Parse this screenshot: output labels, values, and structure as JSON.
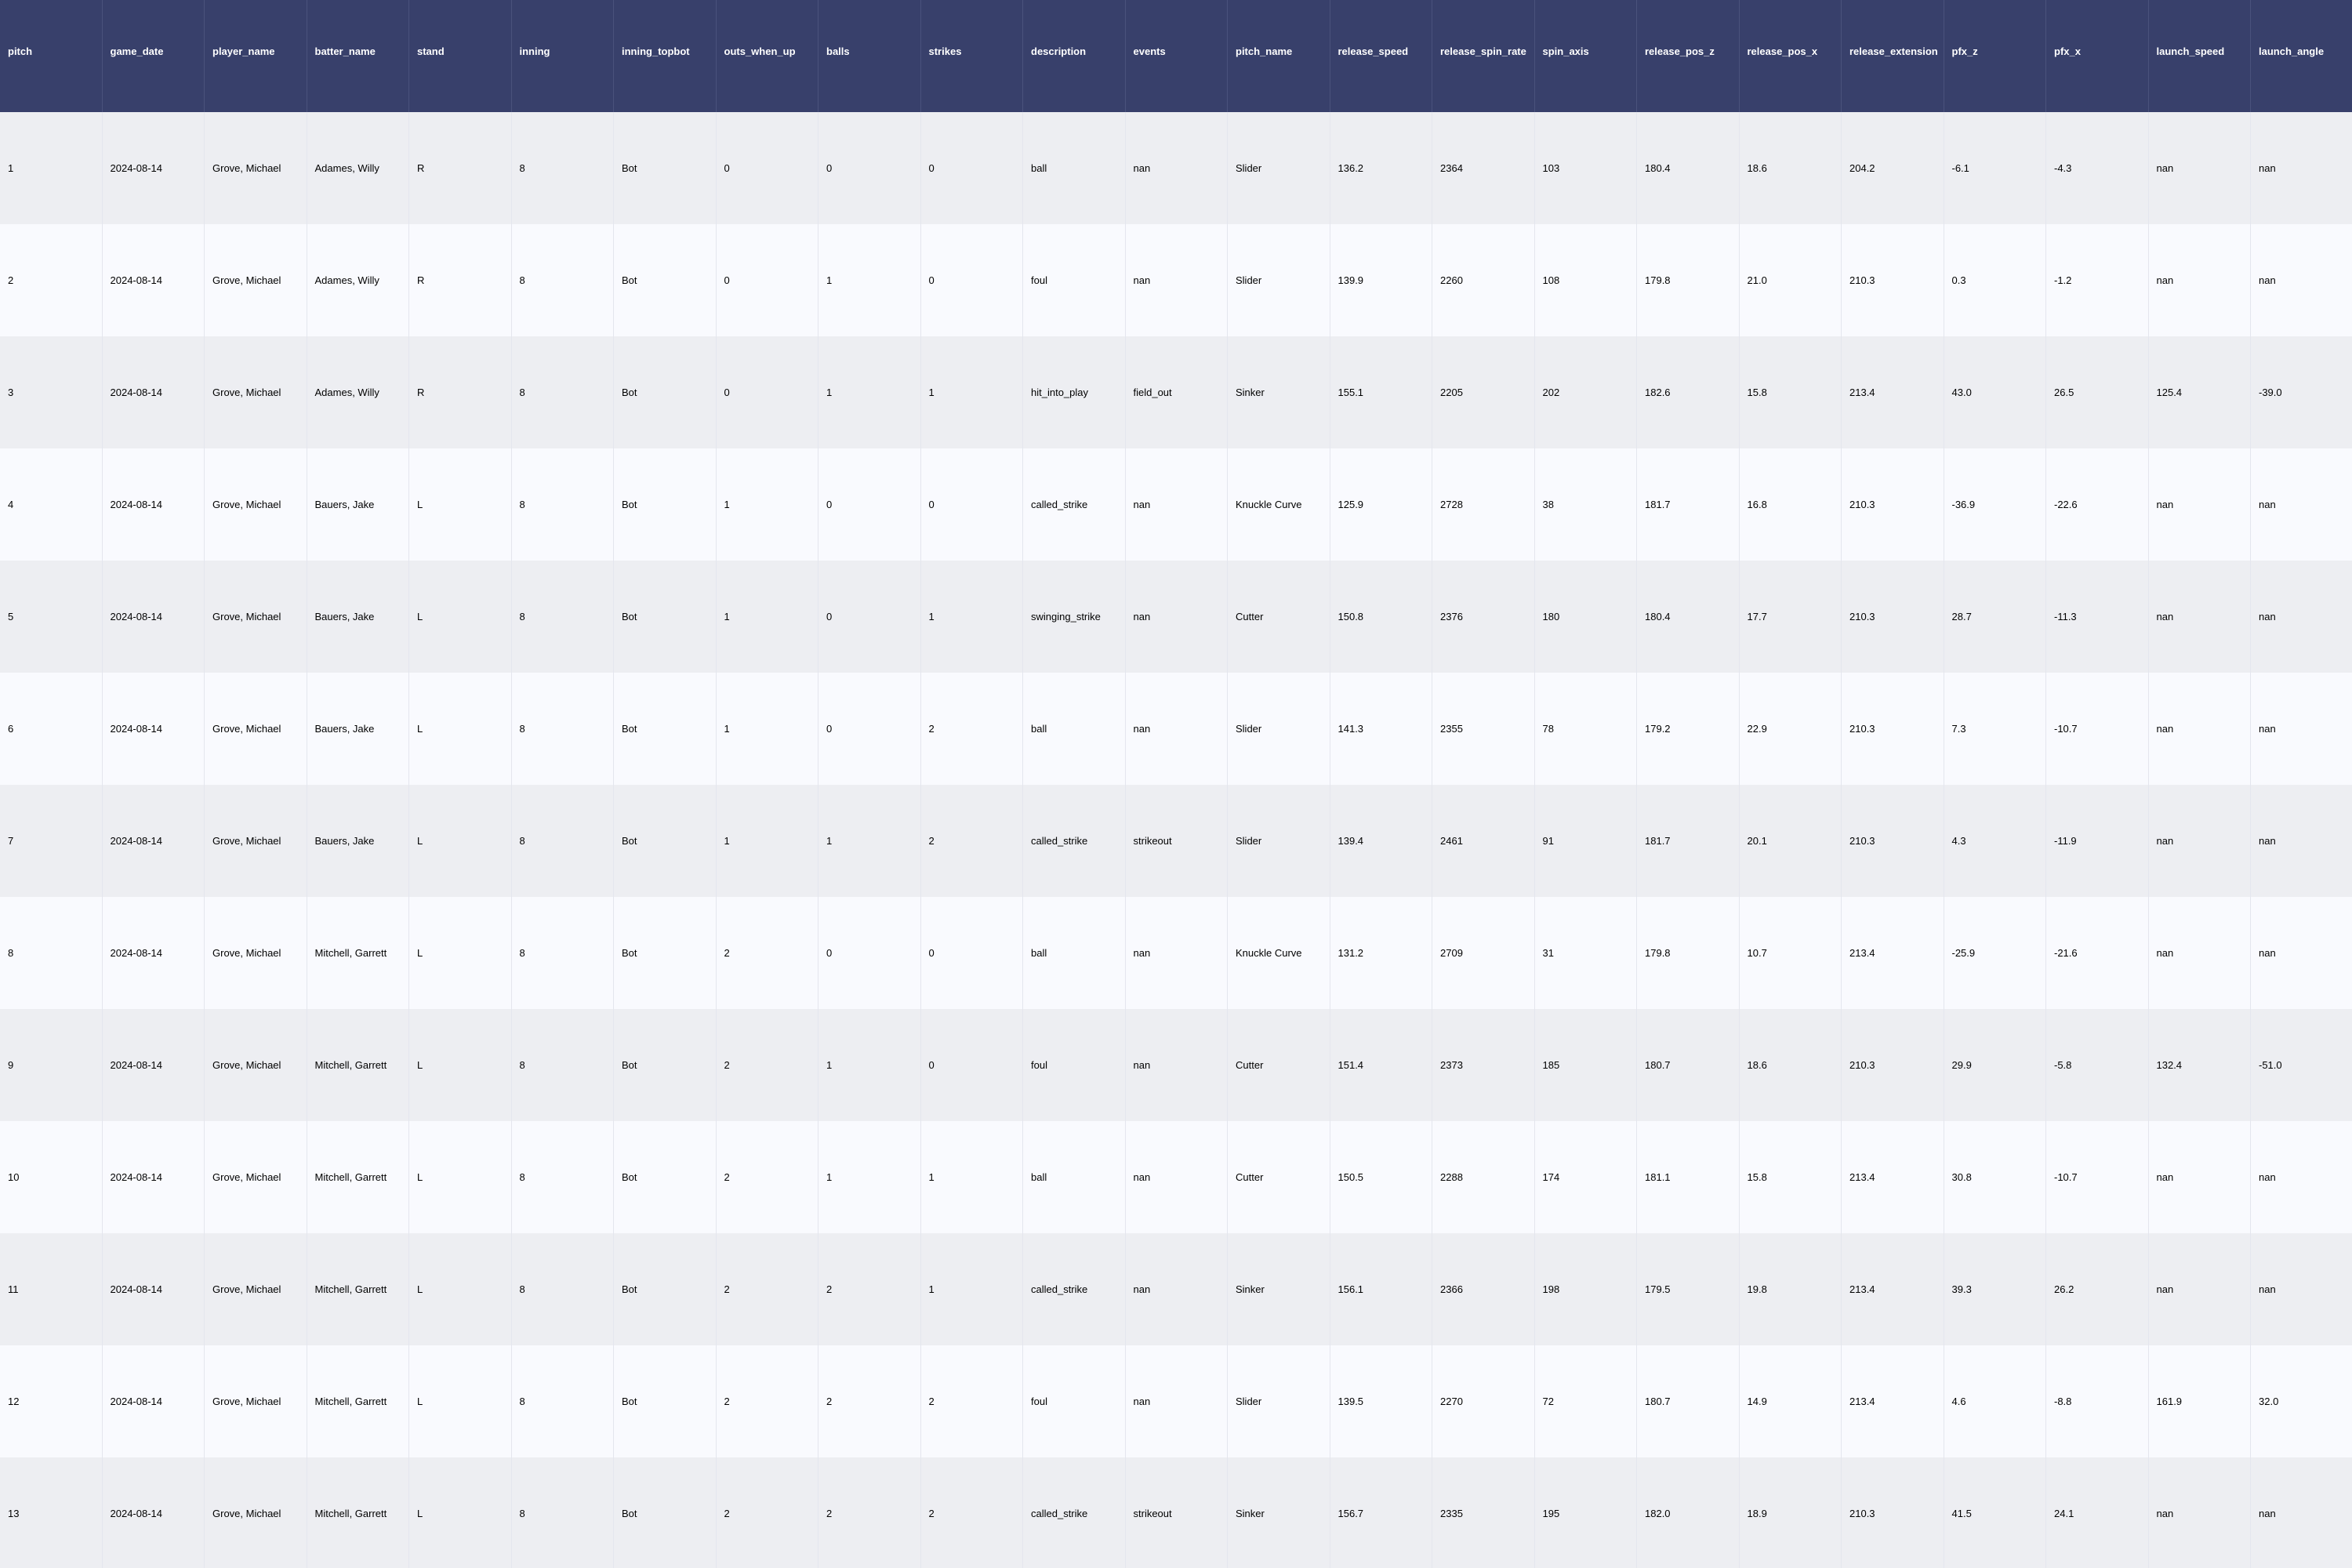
{
  "colors": {
    "header_bg": "#38406b",
    "header_text": "#ffffff",
    "row_odd": "#edeef2",
    "row_even": "#f9fafe"
  },
  "table": {
    "columns": [
      "pitch",
      "game_date",
      "player_name",
      "batter_name",
      "stand",
      "inning",
      "inning_topbot",
      "outs_when_up",
      "balls",
      "strikes",
      "description",
      "events",
      "pitch_name",
      "release_speed",
      "release_spin_rate",
      "spin_axis",
      "release_pos_z",
      "release_pos_x",
      "release_extension",
      "pfx_z",
      "pfx_x",
      "launch_speed",
      "launch_angle"
    ],
    "rows": [
      [
        "1",
        "2024-08-14",
        "Grove, Michael",
        "Adames, Willy",
        "R",
        "8",
        "Bot",
        "0",
        "0",
        "0",
        "ball",
        "nan",
        "Slider",
        "136.2",
        "2364",
        "103",
        "180.4",
        "18.6",
        "204.2",
        "-6.1",
        "-4.3",
        "nan",
        "nan"
      ],
      [
        "2",
        "2024-08-14",
        "Grove, Michael",
        "Adames, Willy",
        "R",
        "8",
        "Bot",
        "0",
        "1",
        "0",
        "foul",
        "nan",
        "Slider",
        "139.9",
        "2260",
        "108",
        "179.8",
        "21.0",
        "210.3",
        "0.3",
        "-1.2",
        "nan",
        "nan"
      ],
      [
        "3",
        "2024-08-14",
        "Grove, Michael",
        "Adames, Willy",
        "R",
        "8",
        "Bot",
        "0",
        "1",
        "1",
        "hit_into_play",
        "field_out",
        "Sinker",
        "155.1",
        "2205",
        "202",
        "182.6",
        "15.8",
        "213.4",
        "43.0",
        "26.5",
        "125.4",
        "-39.0"
      ],
      [
        "4",
        "2024-08-14",
        "Grove, Michael",
        "Bauers, Jake",
        "L",
        "8",
        "Bot",
        "1",
        "0",
        "0",
        "called_strike",
        "nan",
        "Knuckle Curve",
        "125.9",
        "2728",
        "38",
        "181.7",
        "16.8",
        "210.3",
        "-36.9",
        "-22.6",
        "nan",
        "nan"
      ],
      [
        "5",
        "2024-08-14",
        "Grove, Michael",
        "Bauers, Jake",
        "L",
        "8",
        "Bot",
        "1",
        "0",
        "1",
        "swinging_strike",
        "nan",
        "Cutter",
        "150.8",
        "2376",
        "180",
        "180.4",
        "17.7",
        "210.3",
        "28.7",
        "-11.3",
        "nan",
        "nan"
      ],
      [
        "6",
        "2024-08-14",
        "Grove, Michael",
        "Bauers, Jake",
        "L",
        "8",
        "Bot",
        "1",
        "0",
        "2",
        "ball",
        "nan",
        "Slider",
        "141.3",
        "2355",
        "78",
        "179.2",
        "22.9",
        "210.3",
        "7.3",
        "-10.7",
        "nan",
        "nan"
      ],
      [
        "7",
        "2024-08-14",
        "Grove, Michael",
        "Bauers, Jake",
        "L",
        "8",
        "Bot",
        "1",
        "1",
        "2",
        "called_strike",
        "strikeout",
        "Slider",
        "139.4",
        "2461",
        "91",
        "181.7",
        "20.1",
        "210.3",
        "4.3",
        "-11.9",
        "nan",
        "nan"
      ],
      [
        "8",
        "2024-08-14",
        "Grove, Michael",
        "Mitchell, Garrett",
        "L",
        "8",
        "Bot",
        "2",
        "0",
        "0",
        "ball",
        "nan",
        "Knuckle Curve",
        "131.2",
        "2709",
        "31",
        "179.8",
        "10.7",
        "213.4",
        "-25.9",
        "-21.6",
        "nan",
        "nan"
      ],
      [
        "9",
        "2024-08-14",
        "Grove, Michael",
        "Mitchell, Garrett",
        "L",
        "8",
        "Bot",
        "2",
        "1",
        "0",
        "foul",
        "nan",
        "Cutter",
        "151.4",
        "2373",
        "185",
        "180.7",
        "18.6",
        "210.3",
        "29.9",
        "-5.8",
        "132.4",
        "-51.0"
      ],
      [
        "10",
        "2024-08-14",
        "Grove, Michael",
        "Mitchell, Garrett",
        "L",
        "8",
        "Bot",
        "2",
        "1",
        "1",
        "ball",
        "nan",
        "Cutter",
        "150.5",
        "2288",
        "174",
        "181.1",
        "15.8",
        "213.4",
        "30.8",
        "-10.7",
        "nan",
        "nan"
      ],
      [
        "11",
        "2024-08-14",
        "Grove, Michael",
        "Mitchell, Garrett",
        "L",
        "8",
        "Bot",
        "2",
        "2",
        "1",
        "called_strike",
        "nan",
        "Sinker",
        "156.1",
        "2366",
        "198",
        "179.5",
        "19.8",
        "213.4",
        "39.3",
        "26.2",
        "nan",
        "nan"
      ],
      [
        "12",
        "2024-08-14",
        "Grove, Michael",
        "Mitchell, Garrett",
        "L",
        "8",
        "Bot",
        "2",
        "2",
        "2",
        "foul",
        "nan",
        "Slider",
        "139.5",
        "2270",
        "72",
        "180.7",
        "14.9",
        "213.4",
        "4.6",
        "-8.8",
        "161.9",
        "32.0"
      ],
      [
        "13",
        "2024-08-14",
        "Grove, Michael",
        "Mitchell, Garrett",
        "L",
        "8",
        "Bot",
        "2",
        "2",
        "2",
        "called_strike",
        "strikeout",
        "Sinker",
        "156.7",
        "2335",
        "195",
        "182.0",
        "18.9",
        "210.3",
        "41.5",
        "24.1",
        "nan",
        "nan"
      ]
    ]
  }
}
